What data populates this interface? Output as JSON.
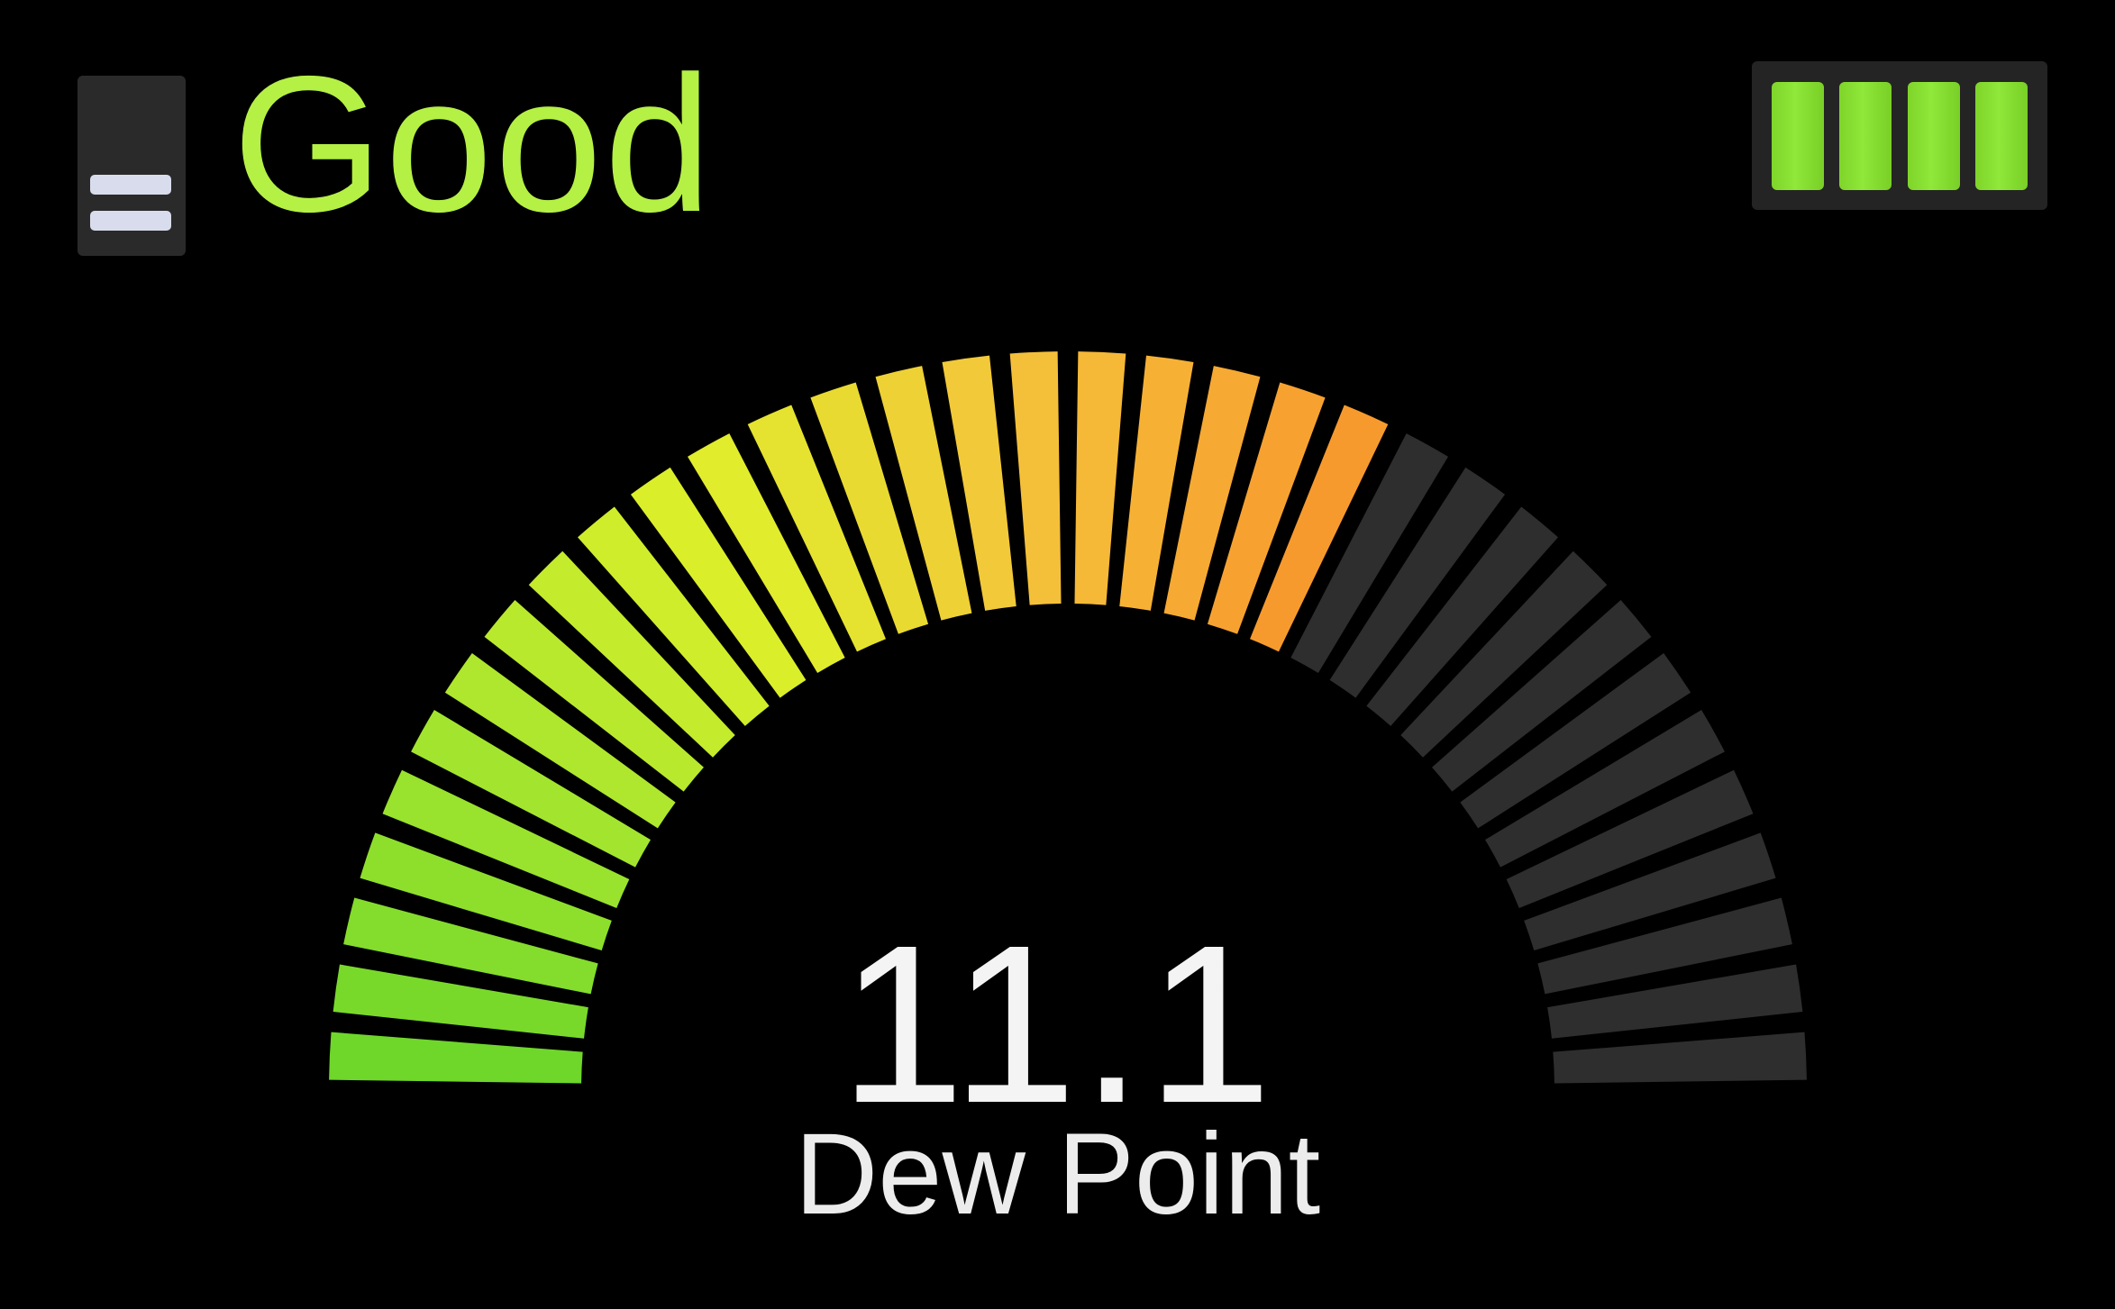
{
  "status": {
    "label": "Good",
    "color": "#b5f045"
  },
  "menu": {
    "icon": "menu-icon"
  },
  "battery": {
    "icon": "battery-icon",
    "level_bars": 4,
    "max_bars": 4,
    "color": "#85dc30"
  },
  "gauge": {
    "segments_total": 34,
    "segments_lit": 22,
    "lit_colors": [
      "#6fd62a",
      "#a6e62e",
      "#dff02a",
      "#f5c23a",
      "#f79a2e"
    ],
    "unlit_color": "#2e2e2e"
  },
  "reading": {
    "value": "11.1",
    "label": "Dew Point"
  }
}
